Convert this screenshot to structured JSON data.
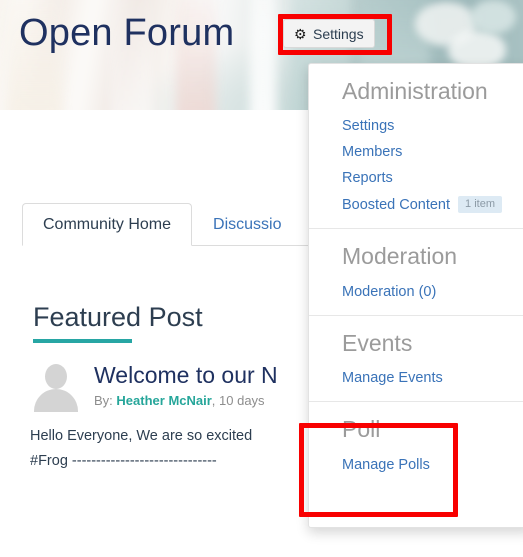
{
  "header": {
    "site_title": "Open Forum",
    "settings_button": {
      "label": "Settings",
      "icon": "gear-icon",
      "glyph": "⚙"
    }
  },
  "tabs": [
    {
      "label": "Community Home",
      "active": true
    },
    {
      "label": "Discussio",
      "active": false
    }
  ],
  "main": {
    "featured_heading": "Featured Post",
    "post": {
      "title": "Welcome to our N",
      "by_label": "By:",
      "author": "Heather McNair",
      "timestamp": ", 10 days",
      "body_line1": "Hello Everyone, We are so excited",
      "body_line2": "#Frog ------------------------------"
    }
  },
  "dropdown": {
    "sections": [
      {
        "heading": "Administration",
        "items": [
          {
            "label": "Settings",
            "badge": null
          },
          {
            "label": "Members",
            "badge": null
          },
          {
            "label": "Reports",
            "badge": null
          },
          {
            "label": "Boosted Content",
            "badge": "1 item"
          }
        ]
      },
      {
        "heading": "Moderation",
        "items": [
          {
            "label": "Moderation (0)",
            "badge": null
          }
        ]
      },
      {
        "heading": "Events",
        "items": [
          {
            "label": "Manage Events",
            "badge": null
          }
        ]
      },
      {
        "heading": "Poll",
        "items": [
          {
            "label": "Manage Polls",
            "badge": null
          }
        ]
      }
    ]
  },
  "highlights": [
    {
      "name": "settings-button-highlight",
      "color": "#f80000"
    },
    {
      "name": "poll-section-highlight",
      "color": "#f80000"
    }
  ],
  "colors": {
    "title_navy": "#1f3160",
    "link_blue": "#3a73b8",
    "heading_gray": "#9b9b9b",
    "accent_teal": "#27a6a4",
    "author_teal": "#26a69a",
    "highlight_red": "#f80000",
    "badge_bg": "#ddeaf4"
  }
}
